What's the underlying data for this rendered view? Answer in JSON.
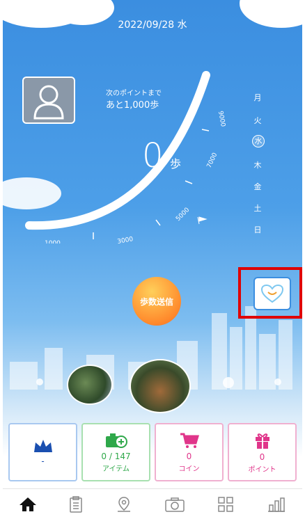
{
  "header": {
    "date": "2022/09/28 水"
  },
  "progress": {
    "next_label": "次のポイントまで",
    "remaining": "あと1,000歩",
    "steps": "0",
    "unit": "歩"
  },
  "gauge": {
    "ticks": [
      "1000",
      "3000",
      "5000",
      "7000",
      "9000"
    ]
  },
  "week": {
    "days": [
      "月",
      "火",
      "水",
      "木",
      "金",
      "土",
      "日"
    ],
    "active_index": 2
  },
  "actions": {
    "send_label": "歩数送信"
  },
  "stats": [
    {
      "value": "-",
      "label": "",
      "color": "#1a4fb0"
    },
    {
      "value": "0 / 147",
      "label": "アイテム",
      "color": "#2fa84a"
    },
    {
      "value": "0",
      "label": "コイン",
      "color": "#e0358a"
    },
    {
      "value": "0",
      "label": "ポイント",
      "color": "#e0358a"
    }
  ],
  "nav": [
    "home-icon",
    "clipboard-icon",
    "map-pin-icon",
    "camera-icon",
    "grid-icon",
    "chart-icon"
  ]
}
